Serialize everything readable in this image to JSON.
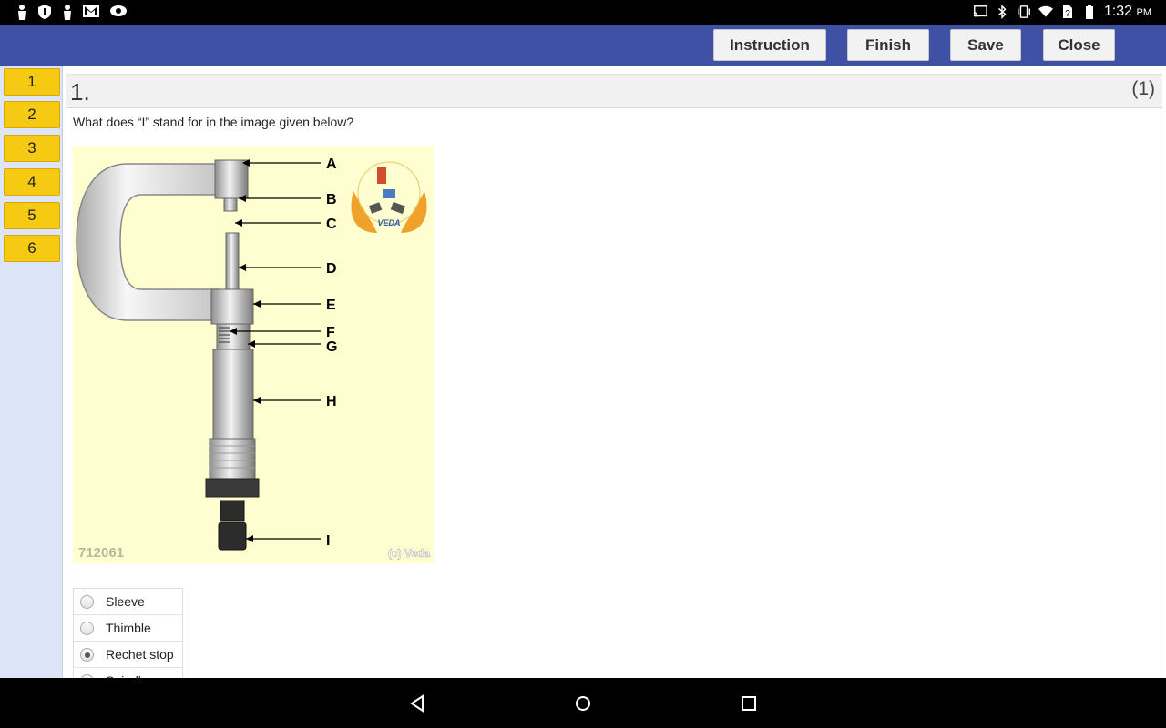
{
  "status_bar": {
    "time": "1:32",
    "ampm": "PM",
    "left_icons": [
      "person-icon",
      "shield-icon",
      "person-icon",
      "gmail-icon",
      "eye-icon"
    ],
    "right_icons": [
      "cast-icon",
      "bluetooth-icon",
      "vibrate-icon",
      "wifi-icon",
      "no-sim-icon",
      "battery-icon"
    ]
  },
  "toolbar": {
    "instruction_label": "Instruction",
    "finish_label": "Finish",
    "save_label": "Save",
    "close_label": "Close"
  },
  "sidebar": {
    "questions": [
      "1",
      "2",
      "3",
      "4",
      "5",
      "6"
    ]
  },
  "question": {
    "number": "1.",
    "marks": "(1)",
    "text": "What does “I” stand for in the image given below?"
  },
  "figure": {
    "labels": [
      "A",
      "B",
      "C",
      "D",
      "E",
      "F",
      "G",
      "H",
      "I"
    ],
    "image_id": "712061",
    "copyright": "(c) Veda",
    "logo_text": "VEDA"
  },
  "options": [
    {
      "label": "Sleeve",
      "selected": false
    },
    {
      "label": "Thimble",
      "selected": false
    },
    {
      "label": "Rechet stop",
      "selected": true
    },
    {
      "label": "Spindle",
      "selected": false
    }
  ],
  "colors": {
    "appbar": "#3f51a5",
    "question_button": "#f6c913",
    "sidebar": "#dce6f8",
    "figure_bg": "#fefed0"
  }
}
